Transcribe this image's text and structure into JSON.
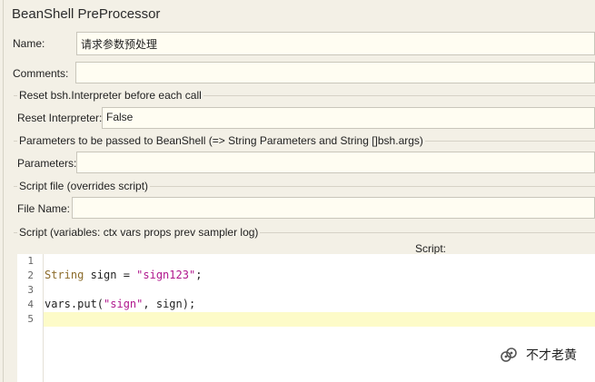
{
  "panel": {
    "title": "BeanShell PreProcessor",
    "name_label": "Name:",
    "name_value": "请求参数预处理",
    "comments_label": "Comments:",
    "comments_value": ""
  },
  "reset_group": {
    "legend": "Reset bsh.Interpreter before each call",
    "label": "Reset Interpreter:",
    "value": "False"
  },
  "params_group": {
    "legend": "Parameters to be passed to BeanShell (=> String Parameters and String []bsh.args)",
    "label": "Parameters:",
    "value": ""
  },
  "file_group": {
    "legend": "Script file (overrides script)",
    "label": "File Name:",
    "value": ""
  },
  "script_group": {
    "legend": "Script (variables: ctx vars props prev sampler log)",
    "header": "Script:",
    "line_numbers": [
      "1",
      "2",
      "3",
      "4",
      "5"
    ],
    "line2": {
      "type": "String",
      "rest": " sign = ",
      "literal": "\"sign123\"",
      "end": ";"
    },
    "line4": {
      "start": "vars.put(",
      "literal": "\"sign\"",
      "end": ", sign);"
    }
  },
  "watermark": {
    "text": "不才老黄",
    "icon": "wechat-official-account-icon"
  }
}
